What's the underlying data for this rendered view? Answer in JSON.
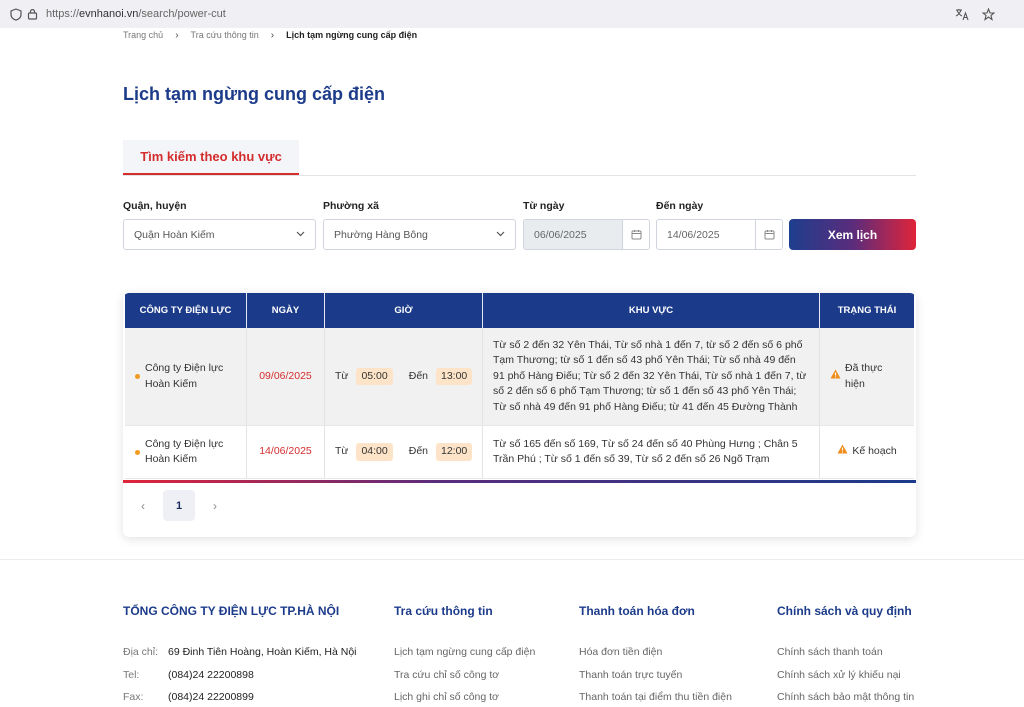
{
  "browser": {
    "url_protocol": "https://",
    "url_domain": "evnhanoi.vn",
    "url_path": "/search/power-cut"
  },
  "breadcrumb": {
    "items": [
      "Trang chủ",
      "Tra cứu thông tin",
      "Lịch tạm ngừng cung cấp điện"
    ]
  },
  "page": {
    "title": "Lịch tạm ngừng cung cấp điện"
  },
  "tabs": {
    "active": "Tìm kiếm theo khu vực"
  },
  "filters": {
    "district_label": "Quận, huyện",
    "district_value": "Quận Hoàn Kiếm",
    "ward_label": "Phường xã",
    "ward_value": "Phường Hàng Bông",
    "from_label": "Từ ngày",
    "from_value": "06/06/2025",
    "to_label": "Đến ngày",
    "to_value": "14/06/2025",
    "submit_label": "Xem lịch"
  },
  "table": {
    "headers": [
      "CÔNG TY ĐIỆN LỰC",
      "NGÀY",
      "GIỜ",
      "KHU VỰC",
      "TRẠNG THÁI"
    ],
    "rows": [
      {
        "company_line1": "Công ty Điện lực",
        "company_line2": "Hoàn Kiếm",
        "date": "09/06/2025",
        "from_word": "Từ",
        "from_time": "05:00",
        "to_word": "Đến",
        "to_time": "13:00",
        "area": "Từ số 2 đến 32 Yên Thái, Từ số nhà 1 đến 7, từ số 2 đến số 6 phố Tạm Thương; từ số 1 đến số 43 phố Yên Thái; Từ số nhà 49 đến 91 phố Hàng Điếu; Từ số 2 đến 32 Yên Thái, Từ số nhà 1 đến 7, từ số 2 đến số 6 phố Tạm Thương; từ số 1 đến số 43 phố Yên Thái; Từ số nhà 49 đến 91 phố Hàng Điếu; từ 41 đến 45 Đường Thành",
        "status": "Đã thực hiện"
      },
      {
        "company_line1": "Công ty Điện lực",
        "company_line2": "Hoàn Kiếm",
        "date": "14/06/2025",
        "from_word": "Từ",
        "from_time": "04:00",
        "to_word": "Đến",
        "to_time": "12:00",
        "area": "Từ số 165 đến số 169, Từ số 24 đến số 40 Phùng Hưng ; Chân 5 Trần Phú ; Từ số 1 đến số 39, Từ số 2 đến số 26 Ngõ Trạm",
        "status": "Kế hoạch"
      }
    ]
  },
  "pagination": {
    "current": "1"
  },
  "footer": {
    "company_title": "TỔNG CÔNG TY ĐIỆN LỰC TP.HÀ NỘI",
    "address_label": "Địa chỉ:",
    "address_value": "69 Đinh Tiên Hoàng, Hoàn Kiếm, Hà Nội",
    "tel_label": "Tel:",
    "tel_value": "(084)24 22200898",
    "fax_label": "Fax:",
    "fax_value": "(084)24 22200899",
    "col2_title": "Tra cứu thông tin",
    "col2_links": [
      "Lịch tạm ngừng cung cấp điện",
      "Tra cứu chỉ số công tơ",
      "Lịch ghi chỉ số công tơ"
    ],
    "col3_title": "Thanh toán hóa đơn",
    "col3_links": [
      "Hóa đơn tiền điện",
      "Thanh toán trực tuyến",
      "Thanh toán tại điểm thu tiền điện"
    ],
    "col4_title": "Chính sách và quy định",
    "col4_links": [
      "Chính sách thanh toán",
      "Chính sách xử lý khiếu nại",
      "Chính sách bảo mật thông tin"
    ]
  },
  "colors": {
    "brand_blue": "#1b3b8a",
    "accent_red": "#d42d2d",
    "time_pill": "#fde4c8",
    "warning": "#f08c1a"
  }
}
